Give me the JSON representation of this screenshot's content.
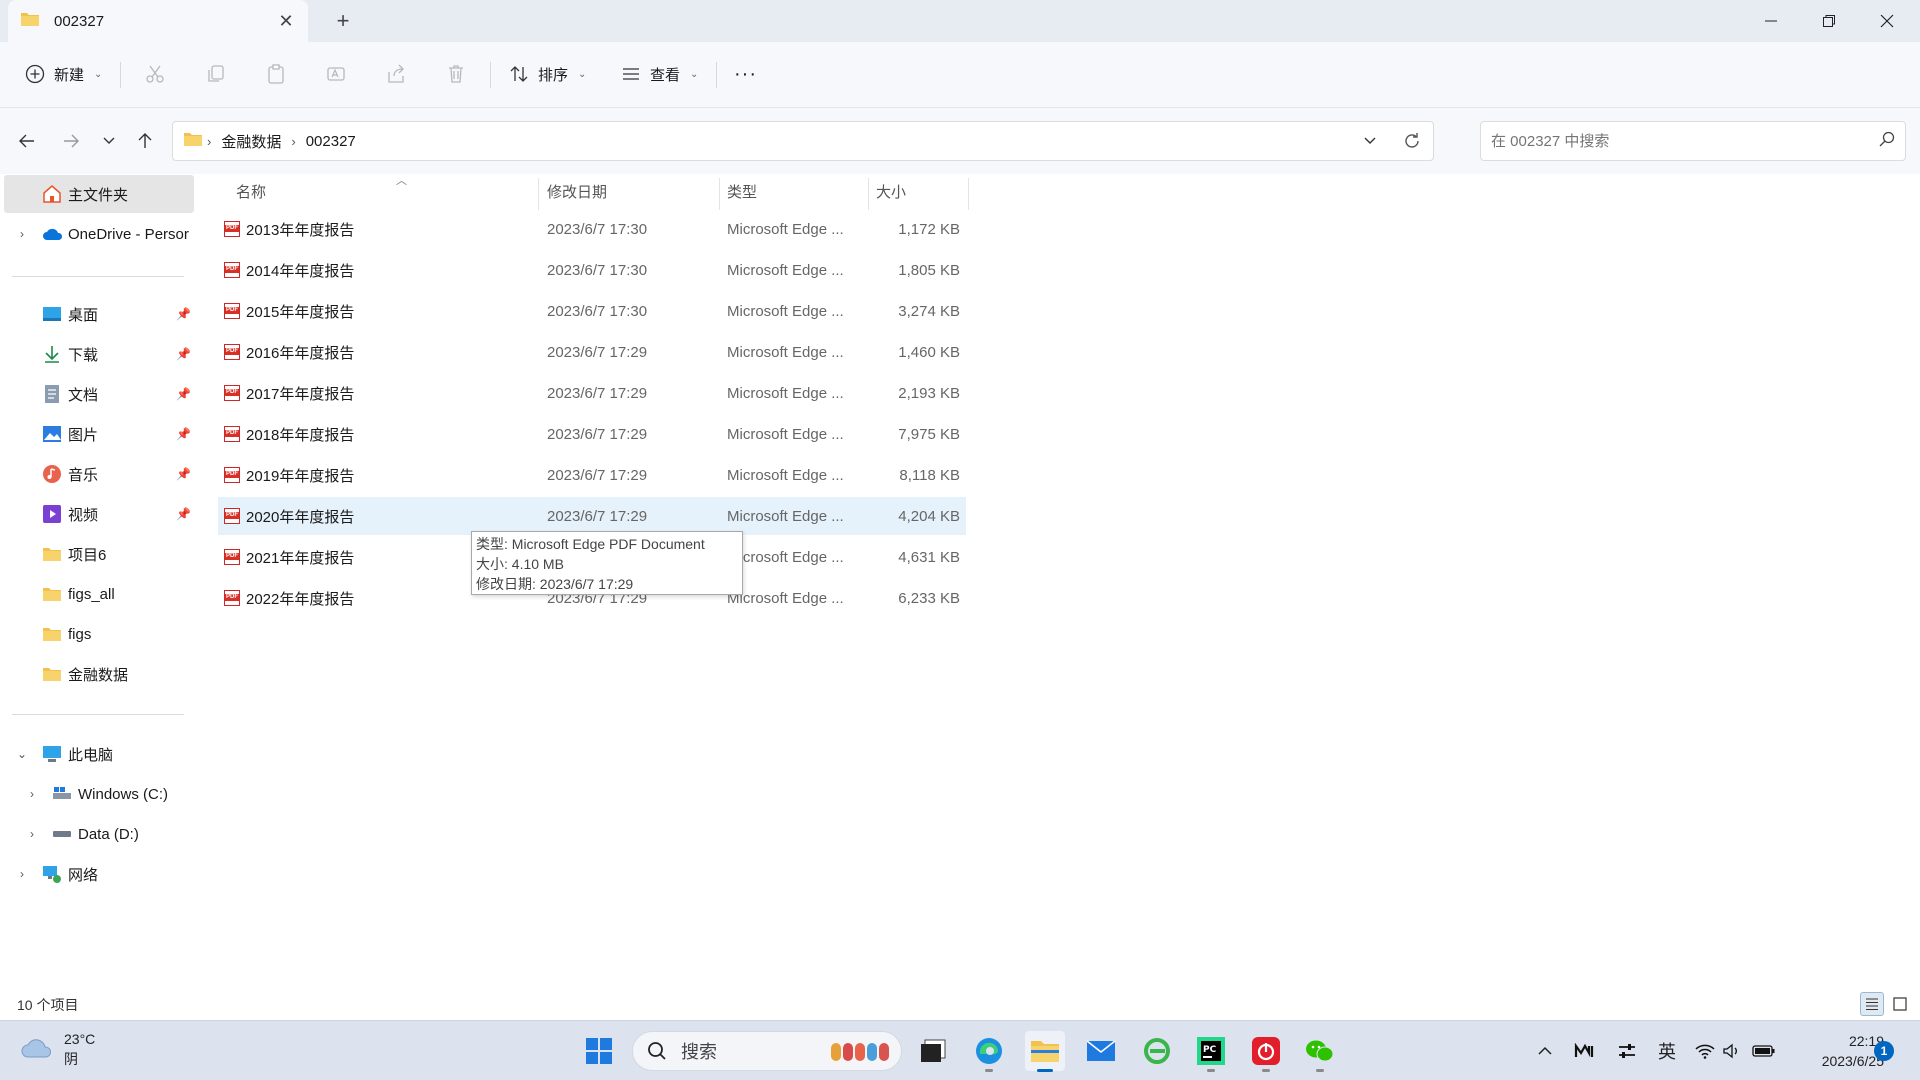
{
  "window": {
    "tab_title": "002327",
    "new_tab": "+",
    "close_tab": "✕"
  },
  "toolbar": {
    "new_label": "新建",
    "sort_label": "排序",
    "view_label": "查看",
    "more_label": "···"
  },
  "address": {
    "crumbs": [
      "金融数据",
      "002327"
    ],
    "search_placeholder": "在 002327 中搜索"
  },
  "sidebar": {
    "home": "主文件夹",
    "onedrive": "OneDrive - Persor",
    "quick": [
      "桌面",
      "下载",
      "文档",
      "图片",
      "音乐",
      "视频",
      "项目6",
      "figs_all",
      "figs",
      "金融数据"
    ],
    "this_pc": "此电脑",
    "drive_c": "Windows (C:)",
    "drive_d": "Data (D:)",
    "network": "网络"
  },
  "columns": {
    "name": "名称",
    "date": "修改日期",
    "type": "类型",
    "size": "大小"
  },
  "files": [
    {
      "name": "2013年年度报告",
      "date": "2023/6/7 17:30",
      "type": "Microsoft Edge ...",
      "size": "1,172 KB"
    },
    {
      "name": "2014年年度报告",
      "date": "2023/6/7 17:30",
      "type": "Microsoft Edge ...",
      "size": "1,805 KB"
    },
    {
      "name": "2015年年度报告",
      "date": "2023/6/7 17:30",
      "type": "Microsoft Edge ...",
      "size": "3,274 KB"
    },
    {
      "name": "2016年年度报告",
      "date": "2023/6/7 17:29",
      "type": "Microsoft Edge ...",
      "size": "1,460 KB"
    },
    {
      "name": "2017年年度报告",
      "date": "2023/6/7 17:29",
      "type": "Microsoft Edge ...",
      "size": "2,193 KB"
    },
    {
      "name": "2018年年度报告",
      "date": "2023/6/7 17:29",
      "type": "Microsoft Edge ...",
      "size": "7,975 KB"
    },
    {
      "name": "2019年年度报告",
      "date": "2023/6/7 17:29",
      "type": "Microsoft Edge ...",
      "size": "8,118 KB"
    },
    {
      "name": "2020年年度报告",
      "date": "2023/6/7 17:29",
      "type": "Microsoft Edge ...",
      "size": "4,204 KB"
    },
    {
      "name": "2021年年度报告",
      "date": "2023/6/7 17:29",
      "type": "Microsoft Edge ...",
      "size": "4,631 KB"
    },
    {
      "name": "2022年年度报告",
      "date": "2023/6/7 17:29",
      "type": "Microsoft Edge ...",
      "size": "6,233 KB"
    }
  ],
  "hovered_row_index": 7,
  "tooltip": {
    "type_line": "类型: Microsoft Edge PDF Document",
    "size_line": "大小: 4.10 MB",
    "date_line": "修改日期: 2023/6/7 17:29"
  },
  "status": {
    "item_count": "10 个项目"
  },
  "taskbar": {
    "temperature": "23°C",
    "condition": "阴",
    "search_label": "搜索",
    "ime": "英",
    "time": "22:19",
    "date": "2023/6/25",
    "notification_count": "1"
  },
  "colors": {
    "accent": "#0067c0",
    "folder": "#f2c14e",
    "hover_row": "#e5f1fb",
    "pdf_red": "#d93025"
  }
}
